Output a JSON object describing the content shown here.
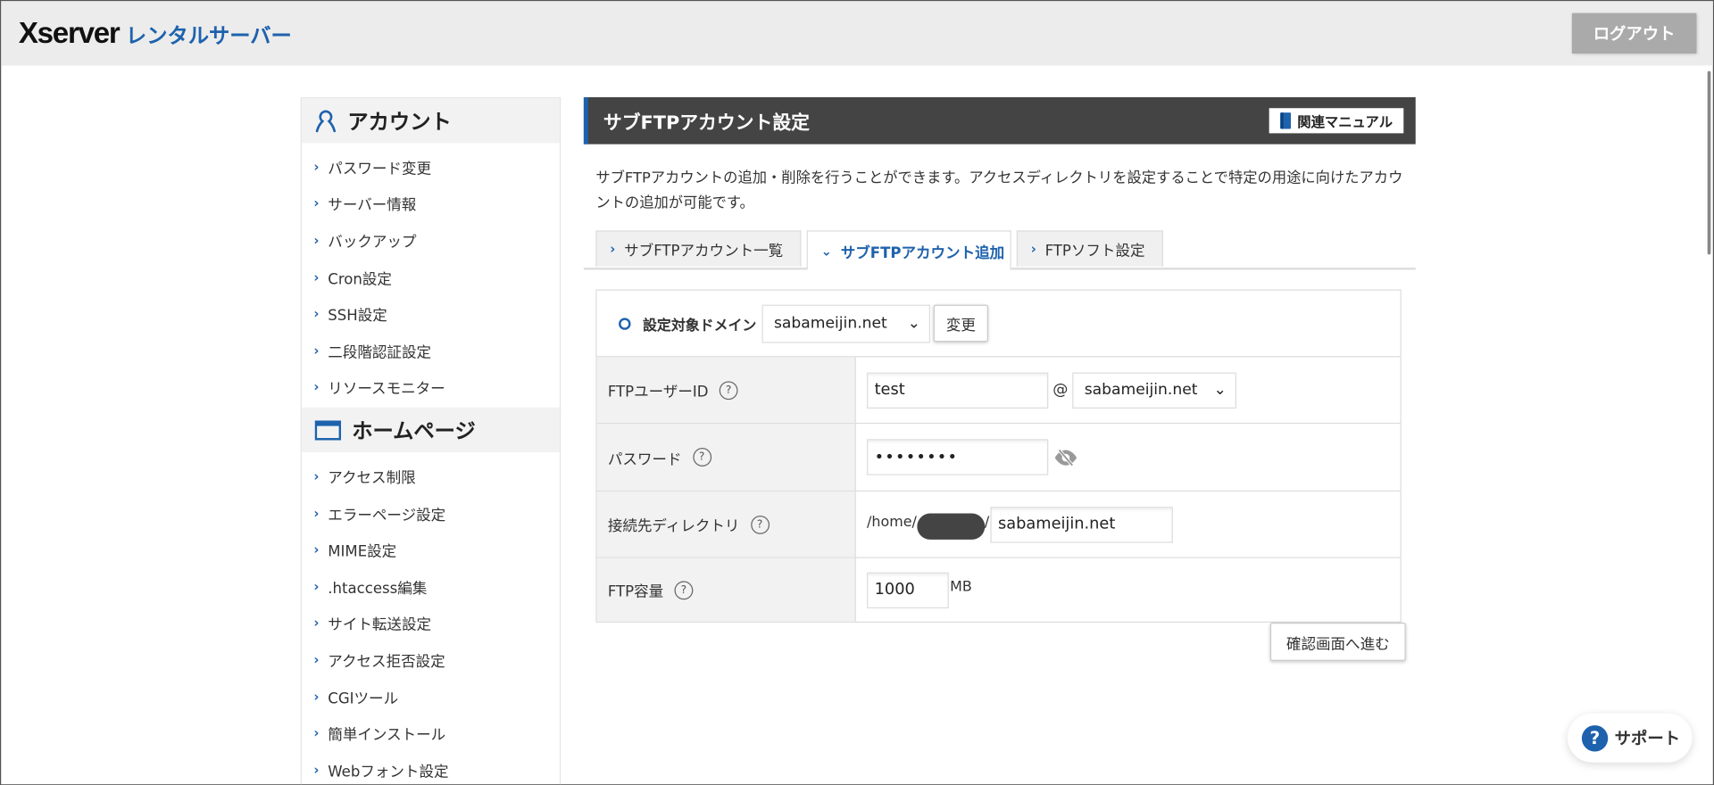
{
  "header": {
    "logo_brand": "Xserver",
    "logo_product": "レンタルサーバー",
    "logout_label": "ログアウト"
  },
  "sidebar": {
    "sections": [
      {
        "title": "アカウント",
        "icon": "person-icon",
        "items": [
          "パスワード変更",
          "サーバー情報",
          "バックアップ",
          "Cron設定",
          "SSH設定",
          "二段階認証設定",
          "リソースモニター"
        ]
      },
      {
        "title": "ホームページ",
        "icon": "browser-window-icon",
        "items": [
          "アクセス制限",
          "エラーページ設定",
          "MIME設定",
          ".htaccess編集",
          "サイト転送設定",
          "アクセス拒否設定",
          "CGIツール",
          "簡単インストール",
          "Webフォント設定"
        ]
      }
    ]
  },
  "main": {
    "title": "サブFTPアカウント設定",
    "manual_label": "関連マニュアル",
    "description": "サブFTPアカウントの追加・削除を行うことができます。アクセスディレクトリを設定することで特定の用途に向けたアカウントの追加が可能です。",
    "tabs": [
      {
        "label": "サブFTPアカウント一覧",
        "active": false
      },
      {
        "label": "サブFTPアカウント追加",
        "active": true
      },
      {
        "label": "FTPソフト設定",
        "active": false
      }
    ],
    "domain": {
      "label": "設定対象ドメイン",
      "selected": "sabameijin.net",
      "change_label": "変更"
    },
    "fields": {
      "user_id": {
        "label": "FTPユーザーID",
        "help": "?",
        "value": "test",
        "at": "@",
        "domain": "sabameijin.net"
      },
      "password": {
        "label": "パスワード",
        "help": "?",
        "value": "••••••••"
      },
      "directory": {
        "label": "接続先ディレクトリ",
        "help": "?",
        "prefix": "/home/",
        "suffix": "/",
        "value": "sabameijin.net"
      },
      "capacity": {
        "label": "FTP容量",
        "help": "?",
        "value": "1000",
        "unit": "MB"
      }
    },
    "confirm_label": "確認画面へ進む"
  },
  "support_label": "サポート",
  "colors": {
    "accent": "#1e62ad",
    "title_bar": "#444444",
    "header_bg": "#ececec"
  }
}
